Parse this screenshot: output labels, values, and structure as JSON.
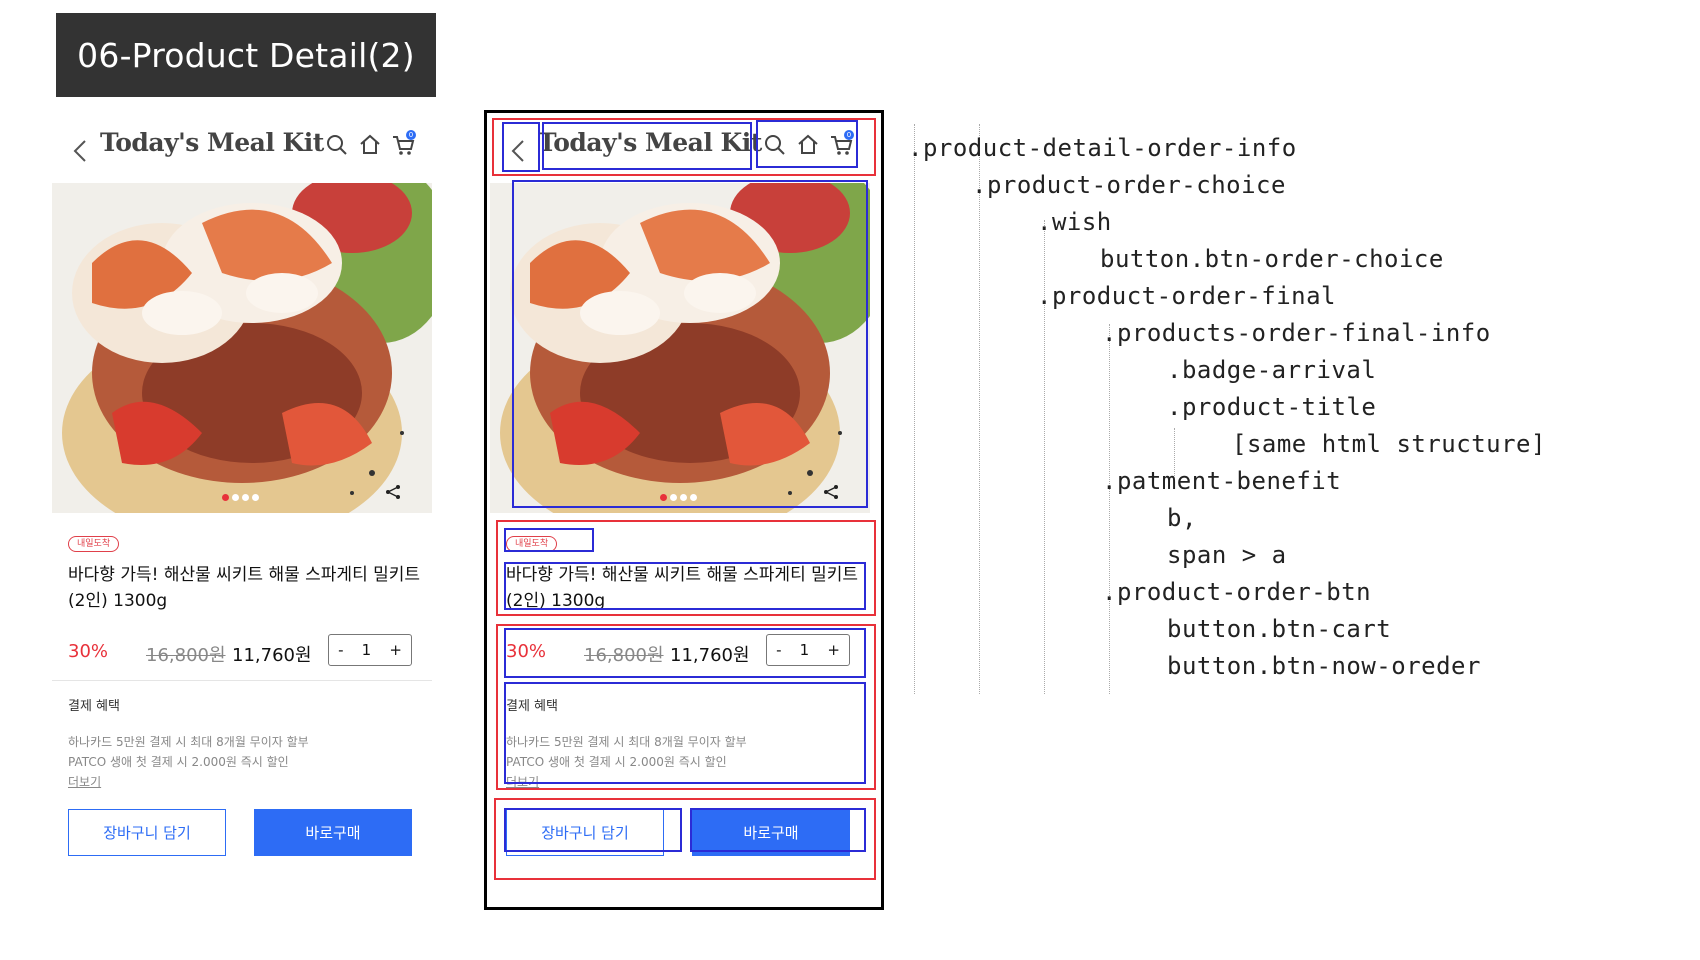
{
  "slide_title": "06-Product Detail(2)",
  "app": {
    "brand": "Today's Meal Kit",
    "cart_count": "0"
  },
  "product": {
    "badge": "내일도착",
    "title": "바다향 가득! 해산물 씨키트 해물 스파게티 밀키트 (2인) 1300g",
    "discount": "30%",
    "original_price": "16,800원",
    "price": "11,760원",
    "quantity": "1",
    "qty_minus": "-",
    "qty_plus": "+",
    "carousel_total": 4,
    "carousel_active": 0
  },
  "benefit": {
    "heading": "결제 혜택",
    "line1": "하나카드 5만원 결제 시 최대 8개월 무이자 할부",
    "line2": "PATCO 생애 첫 결제 시 2.000원 즉시 할인",
    "more": "더보기"
  },
  "buttons": {
    "cart": "장바구니 담기",
    "buy": "바로구매"
  },
  "code_tree": [
    ".product-detail-order-info",
    ".product-order-choice",
    ".wish",
    "button.btn-order-choice",
    ".product-order-final",
    ".products-order-final-info",
    ".badge-arrival",
    ".product-title",
    "[same html structure]",
    ".patment-benefit",
    "b,",
    "span > a",
    ".product-order-btn",
    "button.btn-cart",
    "button.btn-now-oreder"
  ],
  "colors": {
    "accent_blue": "#2d6cf5",
    "sale_red": "#e8313a",
    "outline_red": "#e8313a",
    "outline_blue": "#2b2bd6"
  }
}
